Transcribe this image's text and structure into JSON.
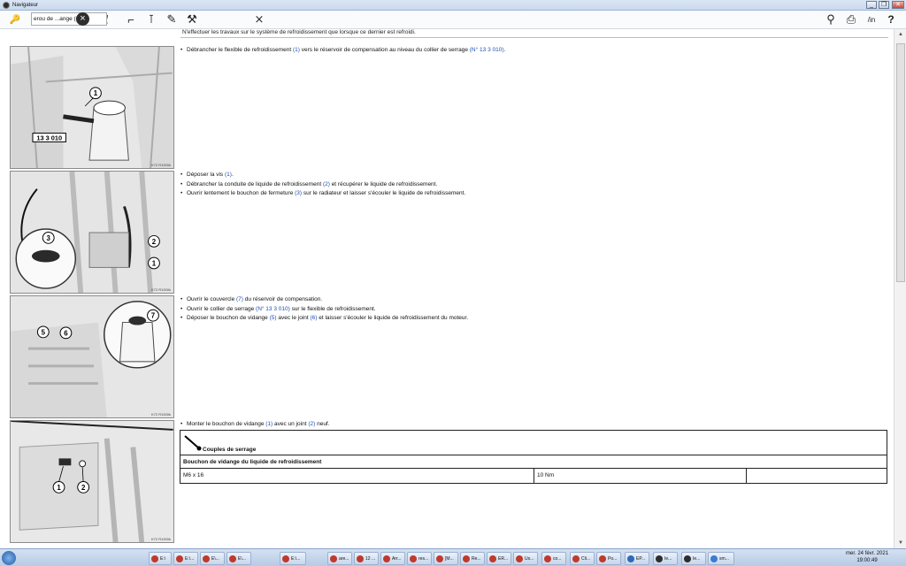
{
  "window": {
    "title": "Navigateur",
    "buttons": [
      "_",
      "❐",
      "✕"
    ]
  },
  "toolbar": {
    "search_value": "erou de ...ange (vid",
    "tools_left": [
      "car-tool-icon",
      "document-icon",
      "crossed-arrows-icon",
      "wrench-icon",
      "torch-icon",
      "spanner-icon",
      "crossed-tools-icon"
    ],
    "tools_right": [
      "magnifier-icon",
      "printer-icon",
      "edit-pen-icon",
      "help-icon"
    ],
    "help_label": "?",
    "pen_label": "/in"
  },
  "content": {
    "top_note": "N'effectuer les travaux sur le système de refroidissement que lorsque ce dernier est refroidi.",
    "steps": [
      {
        "callouts": [
          "1",
          "13 3 010"
        ],
        "image_ref": "K72 R1000k",
        "bullets": [
          {
            "pre": "Débrancher le flexible de refroidissement ",
            "ref1": "(1)",
            "mid": " vers le réservoir de compensation au niveau du collier de serrage ",
            "ref2": "(N° 13 3 010)",
            "post": "."
          }
        ]
      },
      {
        "callouts": [
          "3",
          "2",
          "1"
        ],
        "image_ref": "K72 R1000k",
        "bullets": [
          {
            "pre": "Déposer la vis ",
            "ref1": "(1)",
            "mid": ".",
            "ref2": "",
            "post": ""
          },
          {
            "pre": "Débrancher la conduite de liquide de refroidissement ",
            "ref1": "(2)",
            "mid": " et récupérer le liquide de refroidissement.",
            "ref2": "",
            "post": ""
          },
          {
            "pre": "Ouvrir lentement le bouchon de fermeture ",
            "ref1": "(3)",
            "mid": " sur le radiateur et laisser s'écouler le liquide de refroidissement.",
            "ref2": "",
            "post": ""
          }
        ]
      },
      {
        "callouts": [
          "5",
          "6",
          "7"
        ],
        "image_ref": "K72 R1000k",
        "bullets": [
          {
            "pre": "Ouvrir le couvercle ",
            "ref1": "(7)",
            "mid": " du réservoir de compensation.",
            "ref2": "",
            "post": ""
          },
          {
            "pre": "Ouvrir le collier de serrage ",
            "ref1": "(N° 13 3 010)",
            "mid": " sur le flexible de refroidissement.",
            "ref2": "",
            "post": ""
          },
          {
            "pre": "Déposer le bouchon de vidange ",
            "ref1": "(5)",
            "mid": " avec le joint ",
            "ref2": "(6)",
            "post": " et laisser s'écouler le liquide de refroidissement du moteur."
          }
        ]
      },
      {
        "callouts": [
          "1",
          "2"
        ],
        "image_ref": "K72 R1000k",
        "bullets": [
          {
            "pre": "Monter le bouchon de vidange ",
            "ref1": "(1)",
            "mid": " avec un joint ",
            "ref2": "(2)",
            "post": " neuf."
          }
        ]
      }
    ],
    "torque_table": {
      "header": "Couples de serrage",
      "subheader": "Bouchon de vidange du liquide de refroidissement",
      "thread": "M6 x 16",
      "torque": "10 Nm",
      "extra": ""
    }
  },
  "taskbar": {
    "items": [
      "E:\\",
      "E:\\...",
      "E\\...",
      "E\\...",
      "E:\\...",
      "are...",
      "12 ...",
      "Arr...",
      "res...",
      "[M...",
      "Re...",
      "ER...",
      "Us...",
      "co...",
      "Cli...",
      "Po...",
      "EP...",
      "Ie...",
      "Ie...",
      "sm..."
    ],
    "date": "mer. 24 févr. 2021",
    "time": "19:00:49"
  }
}
